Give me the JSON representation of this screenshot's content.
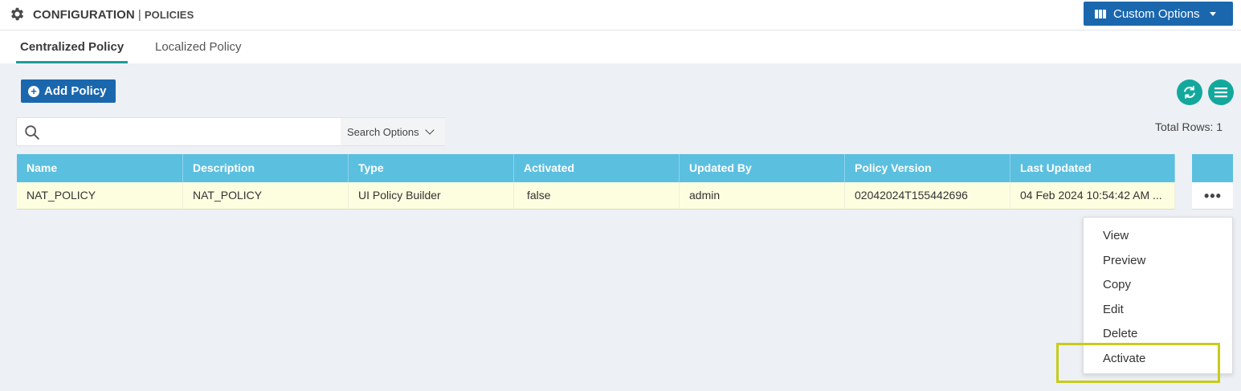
{
  "header": {
    "title": "CONFIGURATION",
    "separator": "|",
    "subtitle": "POLICIES",
    "custom_options_label": "Custom Options"
  },
  "tabs": [
    {
      "label": "Centralized Policy",
      "active": true
    },
    {
      "label": "Localized Policy",
      "active": false
    }
  ],
  "toolbar": {
    "add_policy_label": "Add Policy"
  },
  "search": {
    "placeholder": "",
    "value": "",
    "options_label": "Search Options"
  },
  "table": {
    "total_rows_label": "Total Rows: 1",
    "columns": [
      "Name",
      "Description",
      "Type",
      "Activated",
      "Updated By",
      "Policy Version",
      "Last Updated"
    ],
    "rows": [
      [
        "NAT_POLICY",
        "NAT_POLICY",
        "UI Policy Builder",
        "false",
        "admin",
        "02042024T155442696",
        "04 Feb 2024 10:54:42 AM ..."
      ]
    ],
    "row_actions_label": "•••"
  },
  "context_menu": {
    "items": [
      "View",
      "Preview",
      "Copy",
      "Edit",
      "Delete",
      "Activate"
    ],
    "highlighted": "Activate"
  },
  "colors": {
    "primary_button": "#1a67ae",
    "accent_teal": "#14a89d",
    "table_header": "#5bbfe0",
    "row_background": "#fdfde0",
    "highlight_border": "#c6cc1b",
    "active_tab_underline": "#1f9c9a"
  },
  "icons": {
    "header": "gear-icon",
    "custom_options": "columns-icon",
    "add_policy": "plus-circle-icon",
    "refresh": "refresh-icon",
    "menu": "hamburger-menu-icon",
    "search": "search-icon",
    "search_options": "chevron-down-icon",
    "row_actions": "ellipsis-icon"
  }
}
